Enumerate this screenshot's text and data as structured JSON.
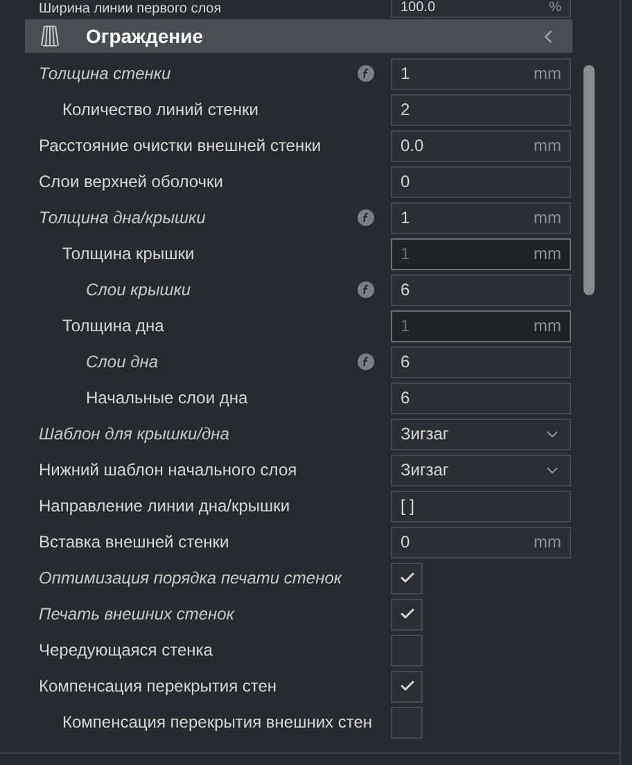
{
  "top_row": {
    "label": "Ширина линии первого слоя",
    "value": "100.0",
    "unit": "%"
  },
  "section": {
    "title": "Ограждение"
  },
  "rows": [
    {
      "kind": "number",
      "label": "Толщина стенки",
      "italic": true,
      "formula": true,
      "value": "1",
      "unit": "mm",
      "disabled": false,
      "children": [
        {
          "kind": "number",
          "label": "Количество линий стенки",
          "italic": false,
          "formula": false,
          "value": "2",
          "disabled": false
        }
      ]
    },
    {
      "kind": "number",
      "label": "Расстояние очистки внешней стенки",
      "italic": false,
      "formula": false,
      "value": "0.0",
      "unit": "mm",
      "disabled": false
    },
    {
      "kind": "number",
      "label": "Слои верхней оболочки",
      "italic": false,
      "formula": false,
      "value": "0",
      "disabled": false
    },
    {
      "kind": "number",
      "label": "Толщина дна/крышки",
      "italic": true,
      "formula": true,
      "value": "1",
      "unit": "mm",
      "disabled": false,
      "children": [
        {
          "kind": "number",
          "label": "Толщина крышки",
          "italic": false,
          "formula": false,
          "value": "1",
          "unit": "mm",
          "disabled": true,
          "children": [
            {
              "kind": "number",
              "label": "Слои крышки",
              "italic": true,
              "formula": true,
              "value": "6",
              "disabled": false
            }
          ]
        },
        {
          "kind": "number",
          "label": "Толщина дна",
          "italic": false,
          "formula": false,
          "value": "1",
          "unit": "mm",
          "disabled": true,
          "children": [
            {
              "kind": "number",
              "label": "Слои дна",
              "italic": true,
              "formula": true,
              "value": "6",
              "disabled": false
            },
            {
              "kind": "number",
              "label": "Начальные слои дна",
              "italic": false,
              "formula": false,
              "value": "6",
              "disabled": false
            }
          ]
        }
      ]
    },
    {
      "kind": "select",
      "label": "Шаблон для крышки/дна",
      "italic": true,
      "formula": false,
      "value": "Зигзаг"
    },
    {
      "kind": "select",
      "label": "Нижний шаблон начального слоя",
      "italic": false,
      "formula": false,
      "value": "Зигзаг"
    },
    {
      "kind": "number",
      "label": "Направление линии дна/крышки",
      "italic": false,
      "formula": false,
      "value": "[ ]",
      "disabled": false
    },
    {
      "kind": "number",
      "label": "Вставка внешней стенки",
      "italic": false,
      "formula": false,
      "value": "0",
      "unit": "mm",
      "disabled": false
    },
    {
      "kind": "checkbox",
      "label": "Оптимизация порядка печати стенок",
      "italic": true,
      "formula": false,
      "checked": true
    },
    {
      "kind": "checkbox",
      "label": "Печать внешних стенок",
      "italic": true,
      "formula": false,
      "checked": true
    },
    {
      "kind": "checkbox",
      "label": "Чередующаяся стенка",
      "italic": false,
      "formula": false,
      "checked": false
    },
    {
      "kind": "checkbox",
      "label": "Компенсация перекрытия стен",
      "italic": false,
      "formula": false,
      "checked": true,
      "children": [
        {
          "kind": "checkbox",
          "label": "Компенсация перекрытия внешних стен",
          "italic": false,
          "formula": false,
          "checked": false
        }
      ]
    }
  ]
}
